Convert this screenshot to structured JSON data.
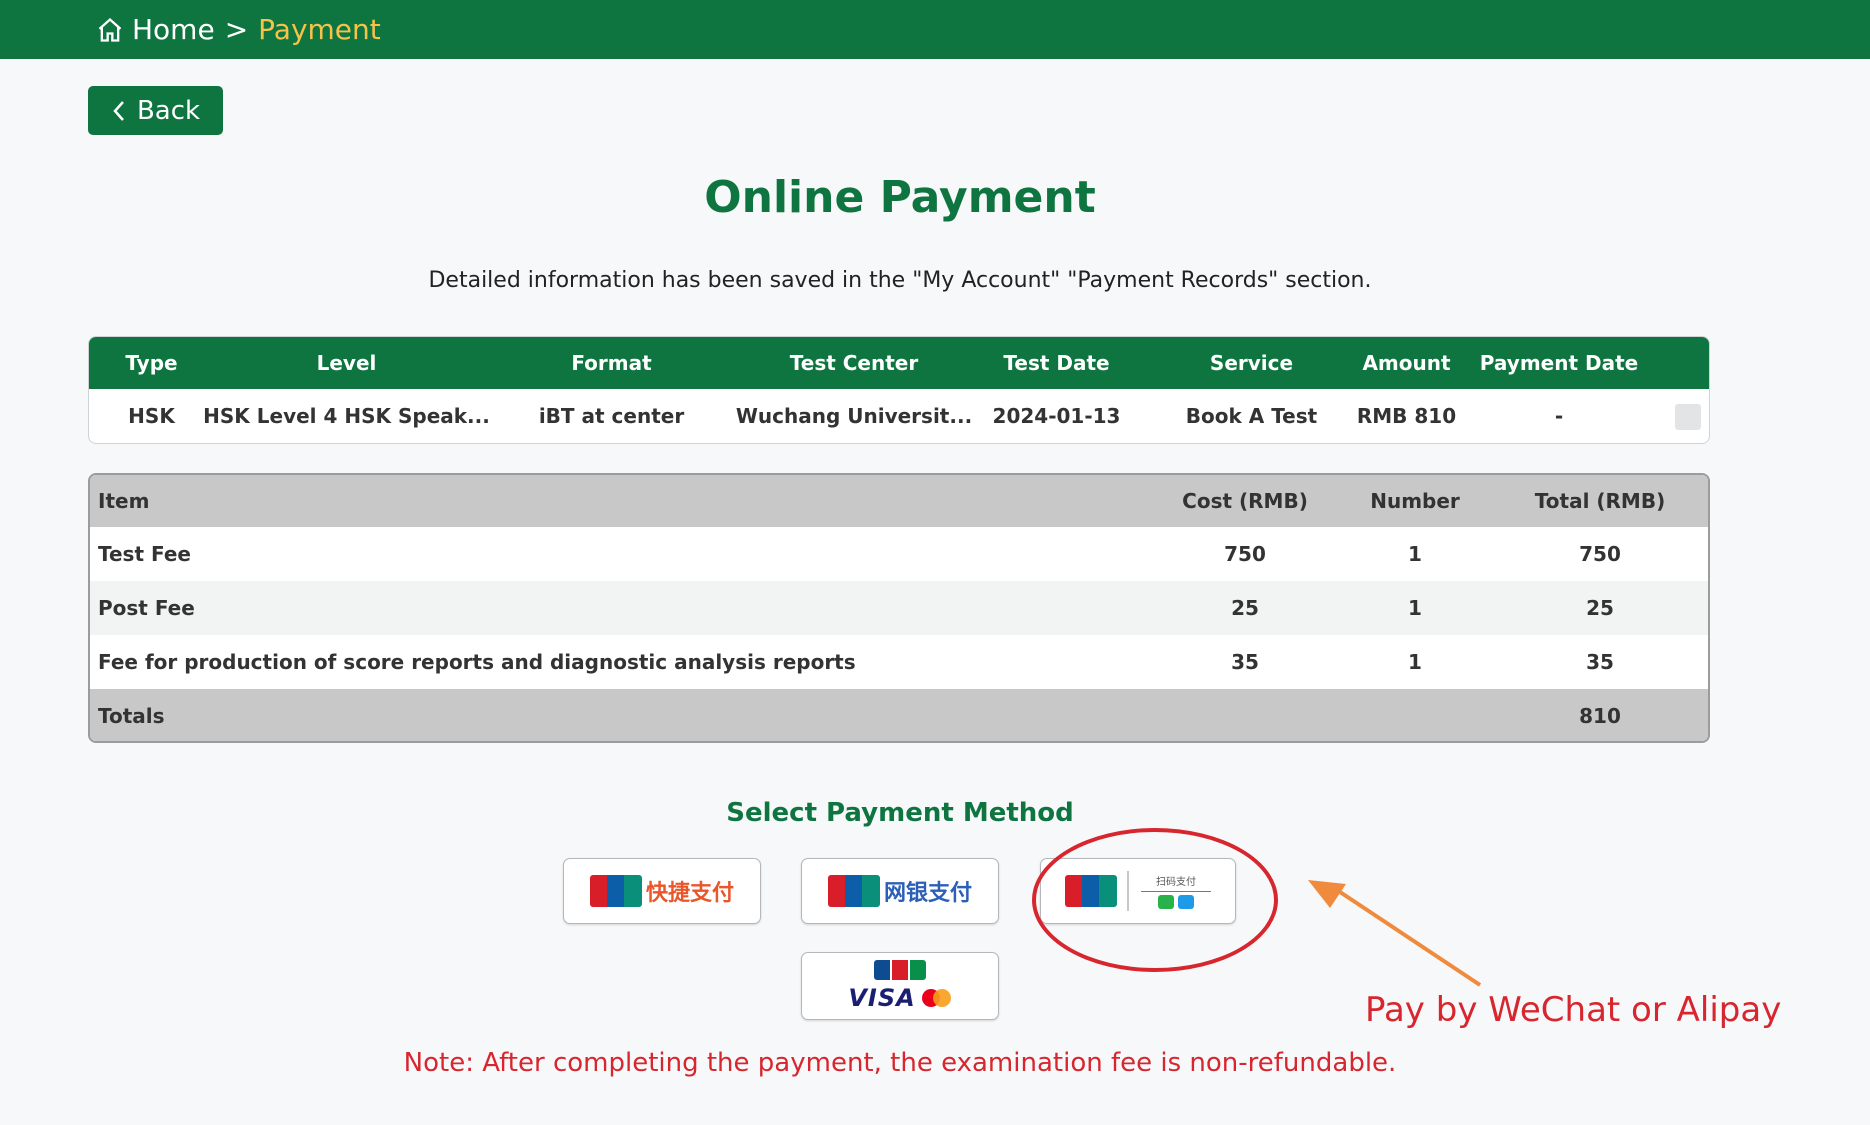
{
  "breadcrumb": {
    "home": "Home",
    "separator": ">",
    "current": "Payment"
  },
  "back_label": "Back",
  "title": "Online Payment",
  "subtitle": "Detailed information has been saved in the \"My Account\" \"Payment Records\" section.",
  "exam_table": {
    "headers": [
      "Type",
      "Level",
      "Format",
      "Test Center",
      "Test Date",
      "Service",
      "Amount",
      "Payment Date"
    ],
    "row": [
      "HSK",
      "HSK Level 4 HSK Speak...",
      "iBT at center",
      "Wuchang Universit...",
      "2024-01-13",
      "Book A Test",
      "RMB 810",
      "-"
    ]
  },
  "fee_table": {
    "headers": {
      "item": "Item",
      "cost": "Cost  (RMB)",
      "number": "Number",
      "total": "Total  (RMB)"
    },
    "rows": [
      {
        "item": "Test Fee",
        "cost": "750",
        "number": "1",
        "total": "750"
      },
      {
        "item": "Post Fee",
        "cost": "25",
        "number": "1",
        "total": "25"
      },
      {
        "item": "Fee for production of score reports and diagnostic analysis reports",
        "cost": "35",
        "number": "1",
        "total": "35"
      }
    ],
    "totals_label": "Totals",
    "totals_value": "810"
  },
  "payment": {
    "title": "Select Payment Method",
    "methods": [
      {
        "label": "快捷支付",
        "label_color": "#e8562a"
      },
      {
        "label": "网银支付",
        "label_color": "#2b5fb8"
      },
      {
        "label": "扫码支付"
      }
    ]
  },
  "annotation": "Pay by WeChat or Alipay",
  "note": "Note: After completing the payment, the examination fee is non-refundable.",
  "colors": {
    "brand": "#0e7540",
    "accent": "#f5c24a",
    "alert": "#d7262e"
  }
}
